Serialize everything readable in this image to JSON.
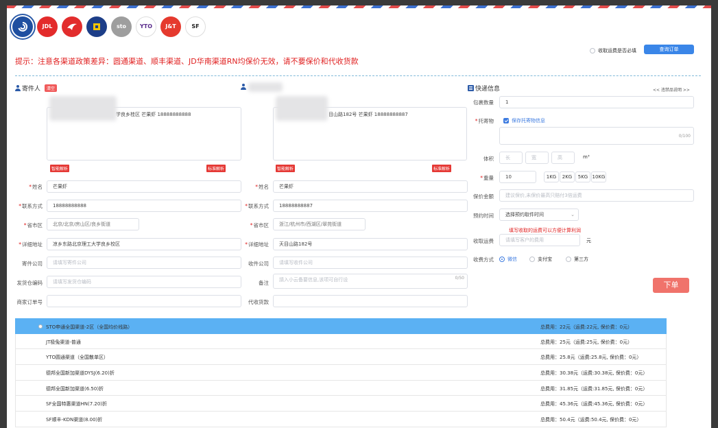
{
  "carriers": [
    {
      "abbr": "",
      "sub": "",
      "color": "#1f4fa0",
      "icon": "swirl-icon"
    },
    {
      "abbr": "JDL",
      "sub": "",
      "color": "#e32b2b",
      "icon": ""
    },
    {
      "abbr": "",
      "sub": "",
      "color": "#e22d2d",
      "icon": "bird-icon"
    },
    {
      "abbr": "",
      "sub": "",
      "color": "#1d3e88",
      "icon": "square-logo-icon"
    },
    {
      "abbr": "sto",
      "sub": "",
      "color": "#9e9e9e",
      "icon": ""
    },
    {
      "abbr": "YTO",
      "sub": "",
      "color": "#5a2c8c",
      "icon": ""
    },
    {
      "abbr": "J&T",
      "sub": "",
      "color": "#e53a2e",
      "icon": ""
    },
    {
      "abbr": "SF",
      "sub": "",
      "color": "#222222",
      "icon": ""
    }
  ],
  "header": {
    "confirm_label": "收取运费是否必填",
    "query_button": "查询订单"
  },
  "notice": "提示：注意各渠道政策差异：圆通渠道、顺丰渠道、JD华南渠道RN均保价无效，请不要保价和代收货款",
  "sender": {
    "title": "寄件人",
    "badge": "清空",
    "paste_text": "学良乡桂区  芒果虾 18888888888",
    "smart_btn": "智能解析",
    "std_btn": "标准解析",
    "name_label": "姓名",
    "name": "芒果虾",
    "phone_label": "联系方式",
    "phone": "18888888888",
    "region_label": "省市区",
    "region": "北京/北京/房山区/良乡街道",
    "address_label": "详细地址",
    "address": "凉乡东路北京理工大学良乡校区",
    "company_label": "寄件公司",
    "company_ph": "请填写寄件公司",
    "warehouse_label": "发货仓编码",
    "warehouse_ph": "请填写发货仓编码",
    "order_label": "商家订单号"
  },
  "receiver": {
    "paste_text": "目山路182号  芒果虾 18888888887",
    "smart_btn": "智能解析",
    "std_btn": "标准解析",
    "name_label": "姓名",
    "name": "芒果虾",
    "phone_label": "联系方式",
    "phone": "18888888887",
    "region_label": "省市区",
    "region": "浙江/杭州市/西湖区/翠苑街道",
    "address_label": "详细地址",
    "address": "天目山路182号",
    "company_label": "收件公司",
    "company_ph": "请填写收件公司",
    "remark_label": "备注",
    "remark_ph": "請入小云备要信息,该项可自行设",
    "remark_count": "0/50",
    "cod_label": "代收货款"
  },
  "express": {
    "title": "快递信息",
    "link": "<< 违禁品说明 >>",
    "qty_label": "包裹数量",
    "qty": "1",
    "goods_label": "托寄物",
    "goods_save": "保存托寄物信息",
    "goods_count": "0/100",
    "volume_label": "体积",
    "len_ph": "长",
    "wid_ph": "宽",
    "hei_ph": "高",
    "vol_unit": "m³",
    "weight_label": "重量",
    "weight": "10",
    "weight_btns": [
      "1KG",
      "2KG",
      "5KG",
      "10KG"
    ],
    "insure_label": "保价金额",
    "insure_ph": "建议保价,未保价最高只赔付3倍运费",
    "time_label": "预约时间",
    "time_value": "选择预约取件时间",
    "fee_hint": "填写收取的运费可以方便计算利润",
    "fee_label": "收取运费",
    "fee_ph": "请填写客户的费用",
    "fee_unit": "元",
    "pay_label": "收费方式",
    "pay_options": [
      "微信",
      "支付宝",
      "第三方"
    ],
    "submit": "下单"
  },
  "channels": [
    {
      "name": "STO申通全国渠道-2区（全国均价线路）",
      "fee": "总费用：22元（运费:22元, 保价费：0元）",
      "selected": true
    },
    {
      "name": "JT极兔渠道-普通",
      "fee": "总费用：25元（运费:25元, 保价费：0元）"
    },
    {
      "name": "YTO圆通渠道（全国散单区）",
      "fee": "总费用：25.8元（运费:25.8元, 保价费：0元）"
    },
    {
      "name": "德邦全国新加渠道DYSJ(6.20)折",
      "fee": "总费用：30.38元（运费:30.38元, 保价费：0元）"
    },
    {
      "name": "德邦全国新加渠道(6.50)折",
      "fee": "总费用：31.85元（运费:31.85元, 保价费：0元）"
    },
    {
      "name": "SF全国特惠渠道HN(7.20)折",
      "fee": "总费用：45.36元（运费:45.36元, 保价费：0元）"
    },
    {
      "name": "SF顺丰-KDN渠道(8.00)折",
      "fee": "总费用：50.4元（运费:50.4元, 保价费：0元）"
    }
  ]
}
